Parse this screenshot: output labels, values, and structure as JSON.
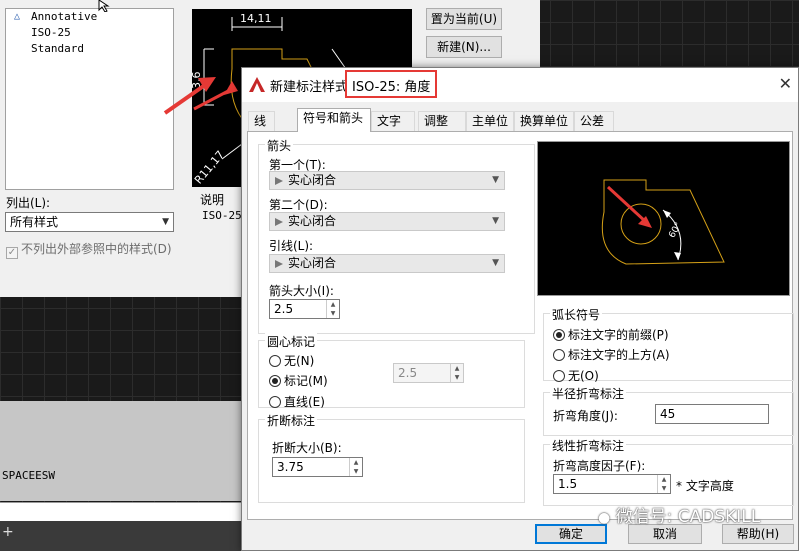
{
  "parent": {
    "style_list": [
      "Annotative",
      "ISO-25",
      "Standard"
    ],
    "buttons": {
      "set_current": "置为当前(U)",
      "new": "新建(N)..."
    },
    "list_label": "列出(L):",
    "list_value": "所有样式",
    "exclude_xref_label": "不列出外部参照中的样式(D)",
    "description_label": "说明",
    "description_value": "ISO-25",
    "preview": {
      "dim_linear": "14,11",
      "dim_vertical": "3,6",
      "dim_radius": "R11,17"
    }
  },
  "cmdline": {
    "text": "SPACEESW"
  },
  "dialog": {
    "title_prefix": "新建标注样式:",
    "title_highlight": "ISO-25: 角度",
    "tabs": [
      "线",
      "符号和箭头",
      "文字",
      "调整",
      "主单位",
      "换算单位",
      "公差"
    ],
    "arrows": {
      "title": "箭头",
      "first_label": "第一个(T):",
      "first_value": "实心闭合",
      "second_label": "第二个(D):",
      "second_value": "实心闭合",
      "leader_label": "引线(L):",
      "leader_value": "实心闭合",
      "size_label": "箭头大小(I):",
      "size_value": "2.5"
    },
    "center_mark": {
      "title": "圆心标记",
      "options": [
        "无(N)",
        "标记(M)",
        "直线(E)"
      ],
      "selected": "标记(M)",
      "size_value": "2.5"
    },
    "break": {
      "title": "折断标注",
      "size_label": "折断大小(B):",
      "size_value": "3.75"
    },
    "preview": {
      "angle_label": "60°"
    },
    "arc_symbol": {
      "title": "弧长符号",
      "options": [
        "标注文字的前缀(P)",
        "标注文字的上方(A)",
        "无(O)"
      ],
      "selected": "标注文字的前缀(P)"
    },
    "radius_jog": {
      "title": "半径折弯标注",
      "angle_label": "折弯角度(J):",
      "angle_value": "45"
    },
    "linear_jog": {
      "title": "线性折弯标注",
      "factor_label": "折弯高度因子(F):",
      "factor_value": "1.5",
      "unit_label": "* 文字高度"
    },
    "buttons": {
      "ok": "确定",
      "cancel": "取消",
      "help": "帮助(H)"
    }
  },
  "watermark": "微信号: CADSKILL",
  "colors": {
    "annotation_red": "#e53935",
    "cad_yellow": "#d4a017",
    "focus_blue": "#0078d7"
  },
  "icons": [
    "autocad-logo-icon",
    "close-icon",
    "arrow-pointer-icon",
    "wechat-icon"
  ]
}
